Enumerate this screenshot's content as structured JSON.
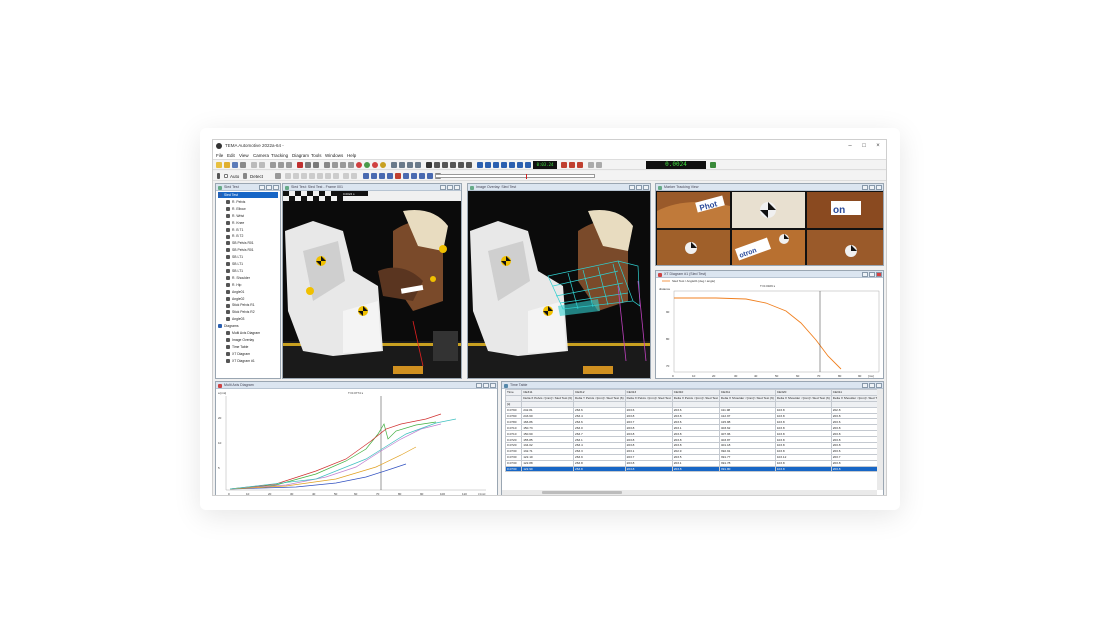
{
  "window": {
    "title": "TEMA Automotive 2022a-64 -",
    "min": "–",
    "max": "□",
    "close": "×"
  },
  "menu": [
    "File",
    "Edit",
    "View",
    "Camera",
    "Tracking",
    "Diagram",
    "Tools",
    "Windows",
    "Help"
  ],
  "toolbar": {
    "time_readout": "0.0024",
    "frame_readout": "0:03.24",
    "auto_label": "Auto",
    "detect_label": "Detect"
  },
  "tree": {
    "title": "Sled Test",
    "items": [
      {
        "label": "Sled Test",
        "indent": 0,
        "selected": true
      },
      {
        "label": "R. Pelvis",
        "indent": 1
      },
      {
        "label": "R. Elbow",
        "indent": 1
      },
      {
        "label": "R. Wrist",
        "indent": 1
      },
      {
        "label": "R. Knee",
        "indent": 1
      },
      {
        "label": "R. B T1",
        "indent": 1
      },
      {
        "label": "R. B T2",
        "indent": 1
      },
      {
        "label": "SB Pelvis R01",
        "indent": 1
      },
      {
        "label": "SB Pelvis R01",
        "indent": 1
      },
      {
        "label": "SB LT1",
        "indent": 1
      },
      {
        "label": "SB LT1",
        "indent": 1
      },
      {
        "label": "SB LT1",
        "indent": 1
      },
      {
        "label": "R. Shoulder",
        "indent": 1
      },
      {
        "label": "R. Hip",
        "indent": 1
      },
      {
        "label": "Angle01",
        "indent": 1
      },
      {
        "label": "Angle02",
        "indent": 1
      },
      {
        "label": "Stick Pelvis R1",
        "indent": 1
      },
      {
        "label": "Stick Pelvis R2",
        "indent": 1
      },
      {
        "label": "Angle03",
        "indent": 1
      },
      {
        "label": "Diagrams",
        "indent": 0
      },
      {
        "label": "Multi Axis Diagram",
        "indent": 1
      },
      {
        "label": "Image Overlay",
        "indent": 1
      },
      {
        "label": "Time Table",
        "indent": 1
      },
      {
        "label": "XT Diagram",
        "indent": 1
      },
      {
        "label": "XT Diagram #1",
        "indent": 1
      }
    ]
  },
  "views": {
    "cam1_title": "Sled Test: Sled Test - Frame 001",
    "cam1_timestamp": "0.0024 s",
    "cam2_title": "Image Overlay: Sled Test",
    "cam3_title": "Marker Tracking View",
    "xt_title": "XT Diagram #1 (Sled Test)"
  },
  "xt_chart": {
    "legend": "Sled Test / Angle01 [deg / angle]",
    "cursor_label": "T=0.0329 s",
    "ylabel": "distance",
    "unit_x": "[ms]"
  },
  "multi_chart": {
    "title": "Multi Axis Diagram",
    "cursor_label": "T=0.0774 s",
    "ylabel": "a [ms]",
    "unit_x": "t [ms]"
  },
  "table": {
    "title": "Time Table",
    "columns": [
      "Time",
      "CE311",
      "CE312",
      "CE313",
      "CE310",
      "CE311",
      "CE320",
      "CE311"
    ],
    "subheader": [
      "",
      "Delta X Pelvis <[mm]> Sled Test (6)",
      "Delta Y Pelvis <[mm]> Sled Test (6)",
      "Delta X Pelvis <[mm]> Sled Test",
      "Delta X Pelvis <[mm]> Sled Test",
      "Delta X Shoulder <[mm]> Sled Test (6)",
      "Delta X Shoulder <[mm]> Sled Test (6)",
      "Delta X Shoulder <[mm]> Sled Test"
    ],
    "subheader_units": [
      "[s]",
      "",
      "",
      "",
      "",
      "",
      "",
      ""
    ],
    "rows": [
      [
        "0.0790",
        "242.81",
        "263.6",
        "203.6",
        "203.6",
        "411.98",
        "103.8",
        "202.8"
      ],
      [
        "0.0790",
        "243.60",
        "263.4",
        "203.8",
        "203.8",
        "412.97",
        "103.8",
        "203.8"
      ],
      [
        "0.0780",
        "166.86",
        "263.6",
        "203.7",
        "203.6",
        "415.88",
        "103.8",
        "203.6"
      ],
      [
        "0.0710",
        "150.73",
        "263.0",
        "203.8",
        "203.1",
        "403.62",
        "103.8",
        "203.8"
      ],
      [
        "0.0710",
        "150.60",
        "263.7",
        "203.8",
        "203.8",
        "407.96",
        "103.8",
        "203.8"
      ],
      [
        "0.0720",
        "155.85",
        "263.1",
        "203.8",
        "203.8",
        "403.87",
        "103.8",
        "203.8"
      ],
      [
        "0.0720",
        "134.02",
        "263.4",
        "203.8",
        "203.8",
        "401.18",
        "103.8",
        "203.8"
      ],
      [
        "0.0730",
        "132.71",
        "263.3",
        "203.1",
        "202.9",
        "392.91",
        "103.8",
        "203.6"
      ],
      [
        "0.0730",
        "122.10",
        "263.9",
        "203.7",
        "203.5",
        "391.77",
        "103.12",
        "203.7"
      ],
      [
        "0.0730",
        "122.88",
        "263.8",
        "203.8",
        "203.1",
        "391.78",
        "103.8",
        "203.8"
      ],
      [
        "0.0730",
        "122.90",
        "263.8",
        "203.8",
        "203.8",
        "391.80",
        "103.8",
        "203.8"
      ]
    ],
    "selected_row": 10
  },
  "colors": {
    "accent": "#1766c6",
    "curve_orange": "#f08020",
    "panel_header": "#dbe5f0"
  }
}
